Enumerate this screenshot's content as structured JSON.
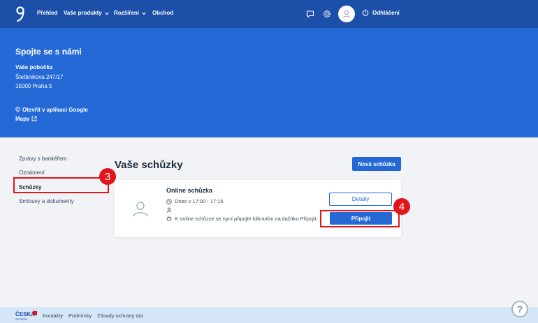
{
  "nav": {
    "items": [
      {
        "label": "Přehled"
      },
      {
        "label": "Vaše produkty"
      },
      {
        "label": "Rozšíření"
      },
      {
        "label": "Obchod"
      }
    ],
    "logout_label": "Odhlášení"
  },
  "banner": {
    "title": "Spojte se s námi",
    "branch_label": "Vaše pobočka",
    "address_line1": "Štefánikova 247/17",
    "address_line2": "15000 Praha 5",
    "maps_link": "Otevřít v aplikaci Google Mapy"
  },
  "sidebar": {
    "items": [
      {
        "label": "Zprávy s bankéřem"
      },
      {
        "label": "Oznámení"
      },
      {
        "label": "Schůzky"
      },
      {
        "label": "Smlouvy a dokumenty"
      }
    ]
  },
  "main": {
    "title": "Vaše schůzky",
    "new_button": "Nová schůzka",
    "meeting": {
      "title": "Online schůzka",
      "time": "Dnes v 17:00 - 17:15",
      "message": "K online schůzce se nyní připojte kliknutím na tlačítko Připojit.",
      "details_button": "Detaily",
      "join_button": "Připojit"
    }
  },
  "annotations": {
    "step3": "3",
    "step4": "4"
  },
  "footer": {
    "logo_line1": "ČESKÁ",
    "logo_line2": "spořitelna",
    "links": [
      {
        "label": "Kontakty"
      },
      {
        "label": "Podmínky"
      },
      {
        "label": "Zásady ochrany dat"
      }
    ],
    "help_label": "?"
  },
  "colors": {
    "nav_bg": "#1b4fa8",
    "banner_bg": "#2469d6",
    "accent": "#2469d6",
    "highlight": "#e3151a",
    "footer_bg": "#d5e6f6"
  },
  "icons": [
    "logo-icon",
    "chevron-down-icon",
    "chat-icon",
    "gear-icon",
    "user-icon",
    "power-icon",
    "map-pin-icon",
    "external-link-icon",
    "clock-icon",
    "person-icon",
    "bot-icon",
    "help-icon"
  ]
}
